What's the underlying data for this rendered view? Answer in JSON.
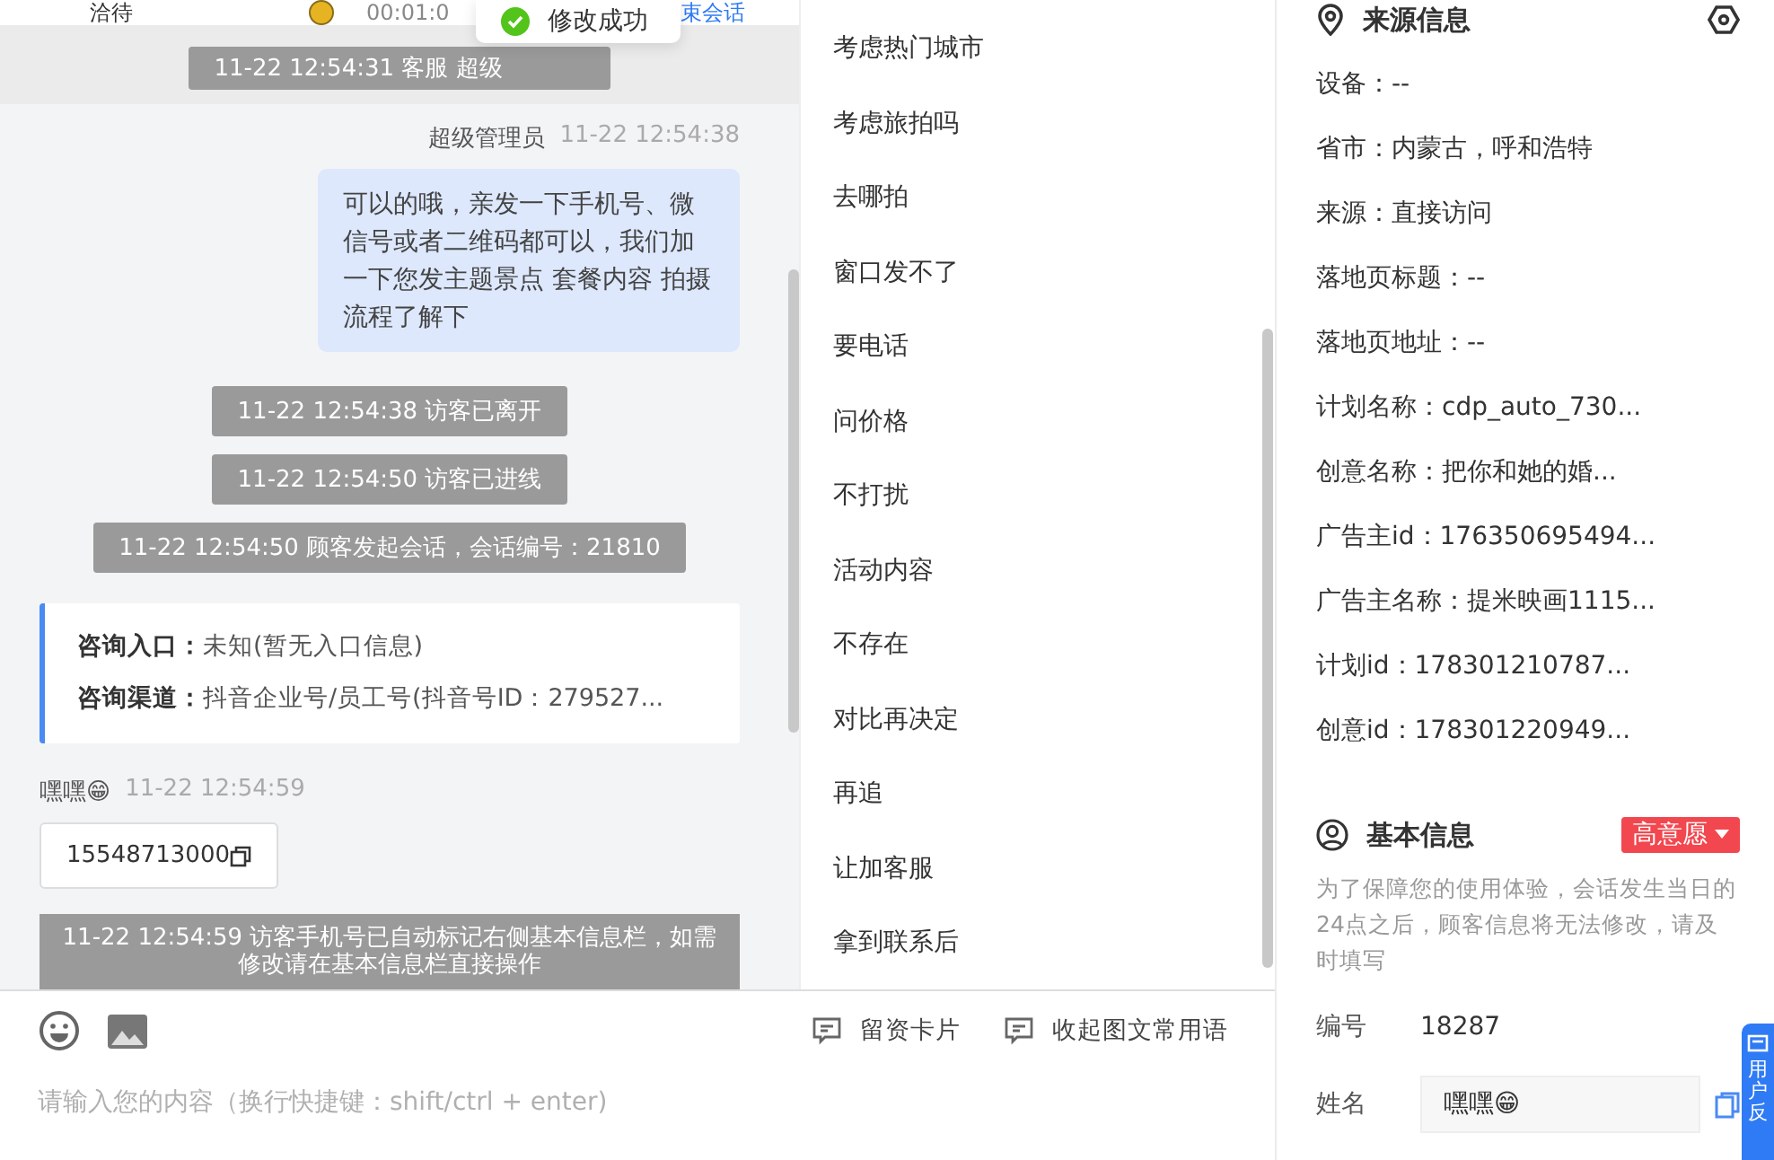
{
  "header": {
    "agent": "洽待",
    "duration": "00:01:0",
    "end_button": "束会话"
  },
  "toast": {
    "text": "修改成功"
  },
  "chat": [
    {
      "kind": "system",
      "text": "11-22 12:54:31 客服 超级"
    },
    {
      "kind": "agent",
      "sender": "超级管理员",
      "time": "11-22 12:54:38",
      "text": "可以的哦，亲发一下手机号、微信号或者二维码都可以，我们加一下您发主题景点 套餐内容 拍摄流程了解下"
    },
    {
      "kind": "system",
      "text": "11-22 12:54:38 访客已离开"
    },
    {
      "kind": "system",
      "text": "11-22 12:54:50 访客已进线"
    },
    {
      "kind": "system",
      "text": "11-22 12:54:50 顾客发起会话，会话编号：21810"
    },
    {
      "kind": "card",
      "rows": [
        {
          "label": "咨询入口：",
          "value": "未知(暂无入口信息)"
        },
        {
          "label": "咨询渠道：",
          "value": "抖音企业号/员工号(抖音号ID：279527..."
        }
      ]
    },
    {
      "kind": "visitor",
      "sender": "嘿嘿😁",
      "time": "11-22 12:54:59",
      "text": "15548713000"
    },
    {
      "kind": "notice",
      "text": "11-22 12:54:59 访客手机号已自动标记右侧基本信息栏，如需修改请在基本信息栏直接操作"
    }
  ],
  "quick_replies": [
    "考虑热门城市",
    "考虑旅拍吗",
    "去哪拍",
    "窗口发不了",
    "要电话",
    "问价格",
    "不打扰",
    "活动内容",
    "不存在",
    "对比再决定",
    "再追",
    "让加客服",
    "拿到联系后"
  ],
  "composer": {
    "placeholder": "请输入您的内容（换行快捷键：shift/ctrl + enter)",
    "tools": [
      "留资卡片",
      "收起图文常用语"
    ]
  },
  "source_info": {
    "title": "来源信息",
    "rows": [
      "设备：--",
      "省市：内蒙古，呼和浩特",
      "来源：直接访问",
      "落地页标题：--",
      "落地页地址：--",
      "计划名称：cdp_auto_730...",
      "创意名称：把你和她的婚...",
      "广告主id：176350695494...",
      "广告主名称：提米映画1115...",
      "计划id：178301210787...",
      "创意id：178301220949..."
    ]
  },
  "basic_info": {
    "title": "基本信息",
    "tag": "高意愿",
    "note": "为了保障您的使用体验，会话发生当日的24点之后，顾客信息将无法修改，请及时填写",
    "fields": [
      {
        "kind": "text",
        "label": "编号",
        "value": "18287"
      },
      {
        "kind": "input",
        "label": "姓名",
        "value": "嘿嘿😁"
      }
    ]
  },
  "feedback_tab": {
    "text": "用户反"
  }
}
